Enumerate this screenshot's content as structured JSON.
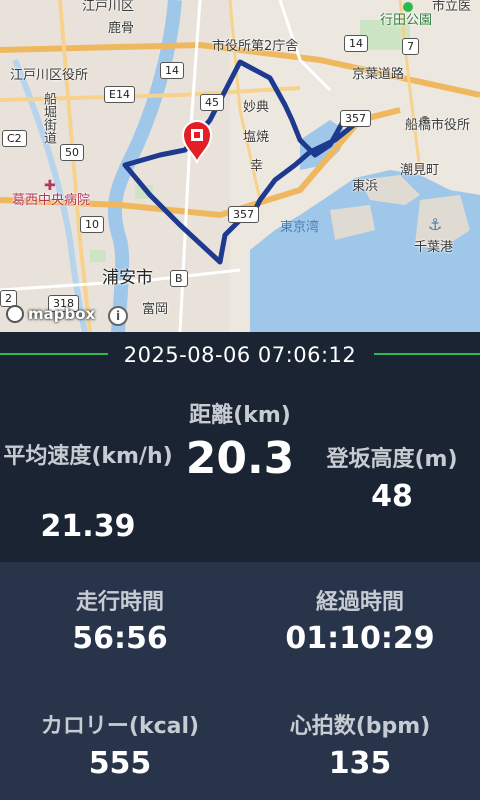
{
  "map": {
    "place_labels": [
      "江戸川区",
      "鹿骨",
      "市役所第2庁舎",
      "江戸川区役所",
      "行田公園",
      "京葉道路",
      "船堀街道",
      "妙典",
      "塩焼",
      "船橋市役所",
      "幸",
      "潮見町",
      "東浜",
      "葛西中央病院",
      "千葉港",
      "東京湾",
      "浦安市",
      "富岡",
      "市立医"
    ],
    "road_numbers": [
      "14",
      "14",
      "E14",
      "45",
      "7",
      "C2",
      "50",
      "357",
      "357",
      "10",
      "B",
      "318",
      "2"
    ],
    "attribution": "mapbox",
    "info_icon_glyph": "i"
  },
  "header": {
    "datetime": "2025-08-06 07:06:12"
  },
  "stats": {
    "distance_label": "距離(km)",
    "distance_value": "20.3",
    "avg_speed_label": "平均速度(km/h)",
    "avg_speed_value": "21.39",
    "elevation_label": "登坂高度(m)",
    "elevation_value": "48",
    "moving_time_label": "走行時間",
    "moving_time_value": "56:56",
    "elapsed_time_label": "経過時間",
    "elapsed_time_value": "01:10:29",
    "calories_label": "カロリー(kcal)",
    "calories_value": "555",
    "heart_rate_label": "心拍数(bpm)",
    "heart_rate_value": "135"
  },
  "colors": {
    "route": "#1d3a8f",
    "pin": "#e31e27",
    "accent_green": "#2fb84c",
    "panel_dark": "#1a2433",
    "panel_mid": "#27344a",
    "water": "#9fc7ea"
  }
}
